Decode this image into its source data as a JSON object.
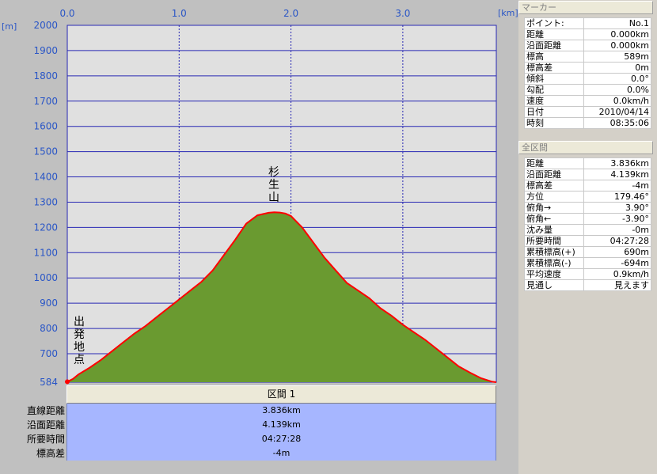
{
  "chart_data": {
    "type": "area",
    "x_unit_label": "[km]",
    "y_unit_label": "[m]",
    "xlim": [
      0,
      3.836
    ],
    "ylim": [
      584,
      2000
    ],
    "x_ticks": [
      "0.0",
      "1.0",
      "2.0",
      "3.0"
    ],
    "y_ticks": [
      "2000",
      "1900",
      "1800",
      "1700",
      "1600",
      "1500",
      "1400",
      "1300",
      "1200",
      "1100",
      "1000",
      "900",
      "800",
      "700",
      "584"
    ],
    "y_tick_values": [
      2000,
      1900,
      1800,
      1700,
      1600,
      1500,
      1400,
      1300,
      1200,
      1100,
      1000,
      900,
      800,
      700,
      584
    ],
    "series": [
      {
        "x": [
          0.0,
          0.05,
          0.1,
          0.2,
          0.3,
          0.4,
          0.5,
          0.6,
          0.7,
          0.8,
          0.9,
          1.0,
          1.1,
          1.2,
          1.3,
          1.4,
          1.5,
          1.6,
          1.7,
          1.8,
          1.85,
          1.9,
          1.95,
          2.0,
          2.1,
          2.2,
          2.3,
          2.4,
          2.5,
          2.6,
          2.7,
          2.8,
          2.9,
          3.0,
          3.1,
          3.2,
          3.3,
          3.4,
          3.5,
          3.6,
          3.7,
          3.8,
          3.836
        ],
        "y": [
          589,
          600,
          618,
          645,
          675,
          710,
          745,
          780,
          810,
          845,
          880,
          915,
          950,
          985,
          1030,
          1090,
          1150,
          1215,
          1248,
          1258,
          1260,
          1259,
          1255,
          1245,
          1200,
          1140,
          1080,
          1030,
          980,
          950,
          920,
          880,
          850,
          815,
          785,
          755,
          720,
          685,
          650,
          625,
          603,
          589,
          585
        ]
      }
    ],
    "annotations": [
      {
        "label": "出発地点",
        "x": 0.0
      },
      {
        "label": "杉生山",
        "x": 1.85
      }
    ],
    "grid": true,
    "colors": {
      "fill": "#6a9a30",
      "line": "#ff0000",
      "plot_bg": "#e0e0e0",
      "grid": "#2828b4",
      "tick_text": "#2a56c6"
    }
  },
  "section": {
    "header": "区間 1",
    "rows": [
      {
        "label": "直線距離",
        "value": "3.836km"
      },
      {
        "label": "沿面距離",
        "value": "4.139km"
      },
      {
        "label": "所要時間",
        "value": "04:27:28"
      },
      {
        "label": "標高差",
        "value": "-4m"
      }
    ]
  },
  "marker_panel": {
    "title": "マーカー",
    "rows": [
      {
        "key": "ポイント:",
        "value": "No.1"
      },
      {
        "key": "距離",
        "value": "0.000km"
      },
      {
        "key": "沿面距離",
        "value": "0.000km"
      },
      {
        "key": "標高",
        "value": "589m"
      },
      {
        "key": "標高差",
        "value": "0m"
      },
      {
        "key": "傾斜",
        "value": "0.0°"
      },
      {
        "key": "勾配",
        "value": "0.0%"
      },
      {
        "key": "速度",
        "value": "0.0km/h"
      },
      {
        "key": "日付",
        "value": "2010/04/14"
      },
      {
        "key": "時刻",
        "value": "08:35:06"
      }
    ]
  },
  "total_panel": {
    "title": "全区間",
    "rows": [
      {
        "key": "距離",
        "value": "3.836km"
      },
      {
        "key": "沿面距離",
        "value": "4.139km"
      },
      {
        "key": "標高差",
        "value": "-4m"
      },
      {
        "key": "方位",
        "value": "179.46°"
      },
      {
        "key": "俯角→",
        "value": "3.90°"
      },
      {
        "key": "俯角←",
        "value": "-3.90°"
      },
      {
        "key": "沈み量",
        "value": "-0m"
      },
      {
        "key": "所要時間",
        "value": "04:27:28"
      },
      {
        "key": "累積標高(+)",
        "value": "690m"
      },
      {
        "key": "累積標高(-)",
        "value": "-694m"
      },
      {
        "key": "平均速度",
        "value": "0.9km/h"
      },
      {
        "key": "見通し",
        "value": "見えます"
      }
    ]
  }
}
